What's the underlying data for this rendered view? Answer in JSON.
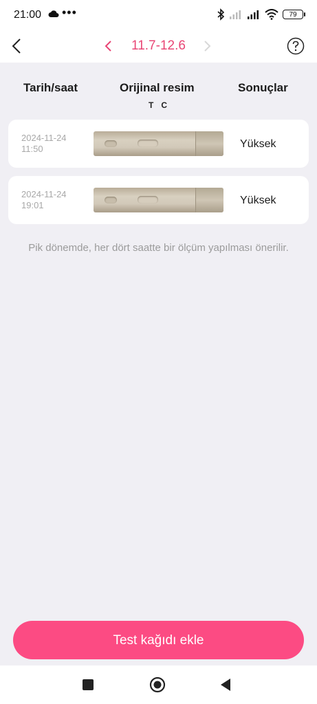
{
  "status_bar": {
    "time": "21:00",
    "dots": "•••",
    "battery": "79"
  },
  "header": {
    "date_range": "11.7-12.6"
  },
  "columns": {
    "date": "Tarih/saat",
    "image": "Orijinal resim",
    "result": "Sonuçlar",
    "t_mark": "T",
    "c_mark": "C"
  },
  "records": [
    {
      "date": "2024-11-24",
      "time": "11:50",
      "result": "Yüksek"
    },
    {
      "date": "2024-11-24",
      "time": "19:01",
      "result": "Yüksek"
    }
  ],
  "hint": "Pik dönemde, her dört saatte bir ölçüm yapılması önerilir.",
  "add_button": "Test kağıdı ekle",
  "colors": {
    "accent": "#fc4b83",
    "range": "#e94675",
    "background": "#f0eff4"
  }
}
